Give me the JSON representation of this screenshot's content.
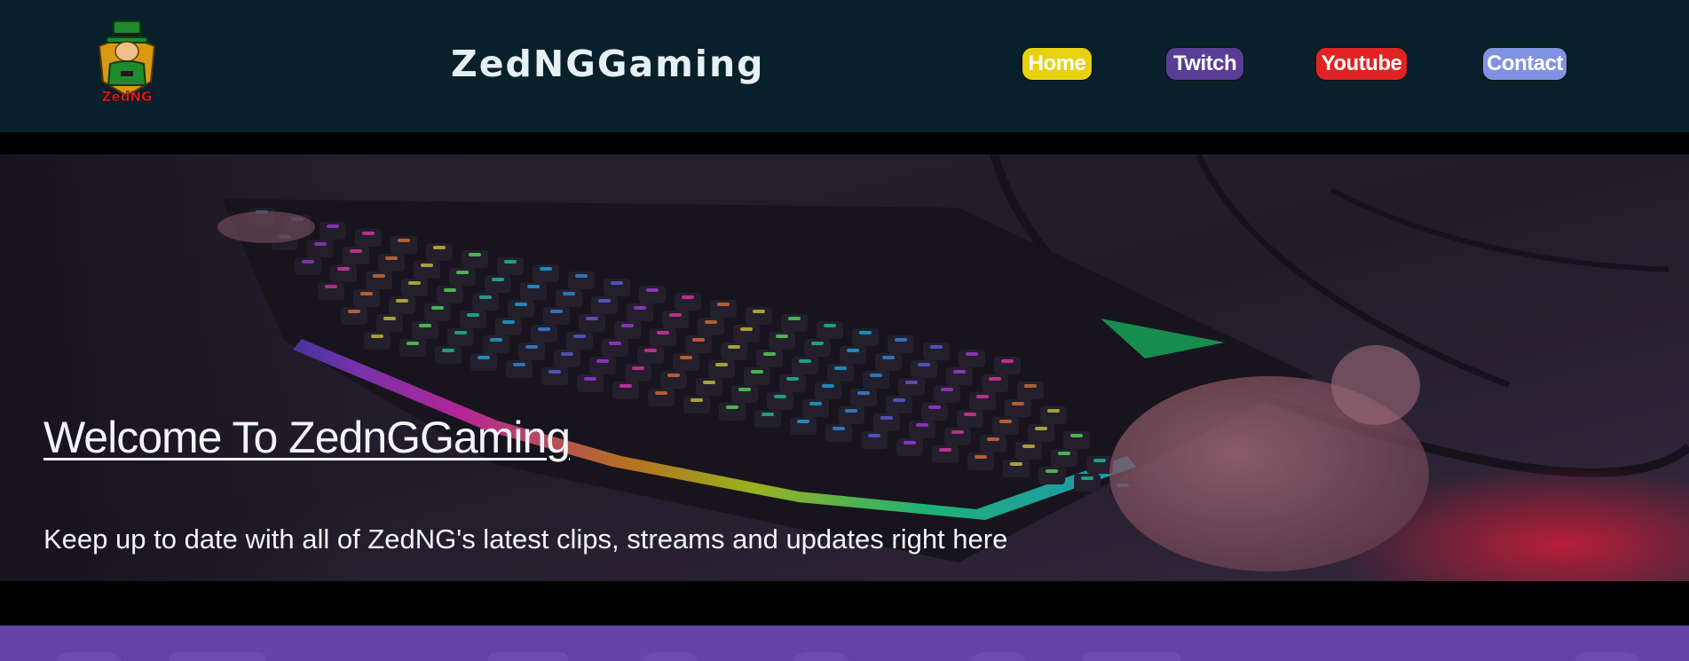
{
  "header": {
    "logo_text": "ZedNG",
    "site_title": "ZedNGGaming"
  },
  "nav": {
    "items": [
      {
        "label": "Home",
        "color": "#e8d20f"
      },
      {
        "label": "Twitch",
        "color": "#5a3d96"
      },
      {
        "label": "Youtube",
        "color": "#e02424"
      },
      {
        "label": "Contact",
        "color": "#8192e0"
      }
    ]
  },
  "hero": {
    "title": "Welcome To ZednGGaming",
    "subtitle": "Keep up to date with all of ZedNG's latest clips, streams and updates right here",
    "image": "rgb-gaming-keyboard-photo"
  },
  "colors": {
    "header_bg": "#07202c",
    "page_bg": "#000000",
    "band_bg": "#6442a6"
  }
}
